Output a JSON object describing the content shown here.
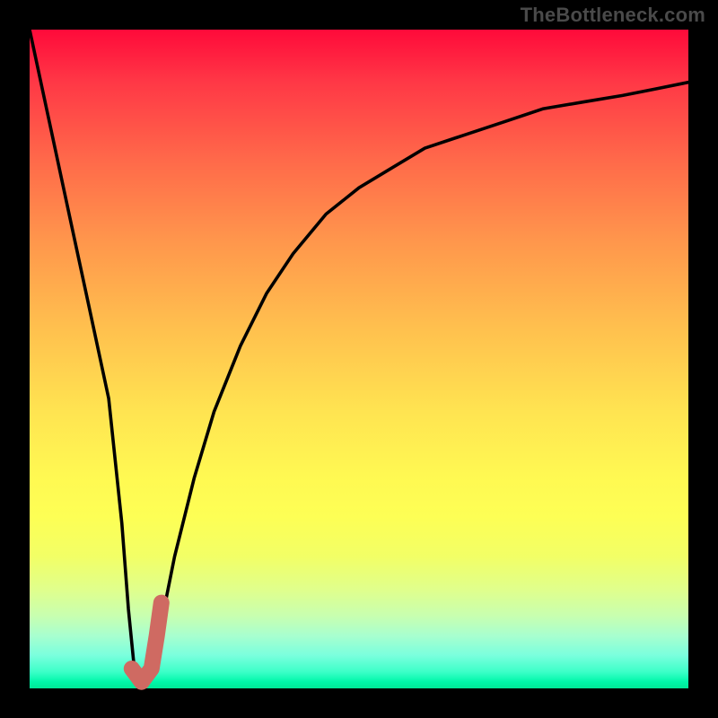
{
  "watermark": "TheBottleneck.com",
  "colors": {
    "frame_background": "#000000",
    "curve_stroke": "#000000",
    "marker_stroke": "#cf6a62",
    "watermark_text": "#4a4a4a"
  },
  "chart_data": {
    "type": "line",
    "title": "",
    "xlabel": "",
    "ylabel": "",
    "xlim": [
      0,
      100
    ],
    "ylim": [
      0,
      100
    ],
    "grid": false,
    "legend": false,
    "annotations": [],
    "series": [
      {
        "name": "bottleneck-curve",
        "x": [
          0,
          3,
          6,
          9,
          12,
          14,
          15,
          16,
          17,
          18,
          20,
          22,
          25,
          28,
          32,
          36,
          40,
          45,
          50,
          55,
          60,
          66,
          72,
          78,
          84,
          90,
          95,
          100
        ],
        "values": [
          100,
          86,
          72,
          58,
          44,
          25,
          12,
          2,
          0,
          2,
          10,
          20,
          32,
          42,
          52,
          60,
          66,
          72,
          76,
          79,
          82,
          84,
          86,
          88,
          89,
          90,
          91,
          92
        ]
      }
    ],
    "marker": {
      "name": "highlight-segment",
      "points": [
        {
          "x": 15.5,
          "y": 3
        },
        {
          "x": 17.0,
          "y": 1
        },
        {
          "x": 18.5,
          "y": 3
        },
        {
          "x": 19.3,
          "y": 8
        },
        {
          "x": 20.0,
          "y": 13
        }
      ]
    },
    "background_gradient": {
      "top": "#ff0a3a",
      "bottom": "#00e896",
      "description": "red-orange-yellow-green vertical gradient"
    }
  }
}
